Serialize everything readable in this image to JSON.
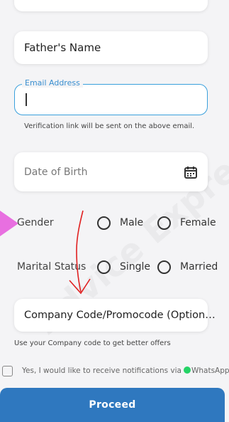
{
  "form": {
    "father_name": "Father's Name",
    "email_label": "Email Address",
    "email_hint": "Verification link will be sent on the above email.",
    "dob_placeholder": "Date of Birth",
    "gender_label": "Gender",
    "gender_options": [
      "Male",
      "Female"
    ],
    "marital_label": "Marital Status",
    "marital_options": [
      "Single",
      "Married"
    ],
    "company_code": "Company Code/Promocode (Option…",
    "company_hint": "Use your Company code to get better offers",
    "notify_text": "Yes, I would like to receive notifications via",
    "notify_channel": "WhatsApp",
    "proceed_label": "Proceed"
  },
  "watermark": "Advice Express",
  "colors": {
    "accent": "#2f78bf",
    "focus_border": "#3aa0dc",
    "annotation": "#e02020",
    "pointer": "#e86fe0",
    "whatsapp": "#25d366"
  }
}
